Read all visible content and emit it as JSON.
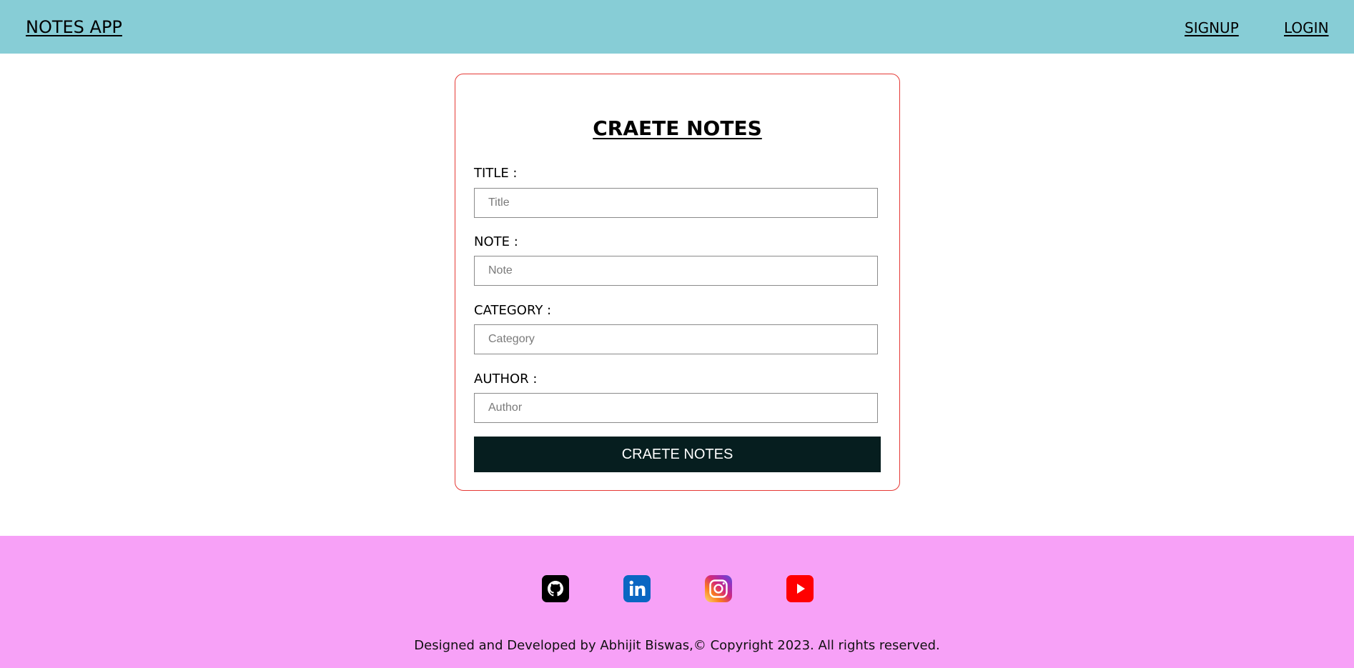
{
  "navbar": {
    "brand": "NOTES APP",
    "links": [
      {
        "label": "SIGNUP"
      },
      {
        "label": "LOGIN"
      }
    ],
    "background": "#87cdd6"
  },
  "form": {
    "title": "CRAETE NOTES",
    "border_color": "#e53935",
    "fields": [
      {
        "label": "TITLE :",
        "placeholder": "Title",
        "value": ""
      },
      {
        "label": "NOTE :",
        "placeholder": "Note",
        "value": ""
      },
      {
        "label": "CATEGORY :",
        "placeholder": "Category",
        "value": ""
      },
      {
        "label": "AUTHOR :",
        "placeholder": "Author",
        "value": ""
      }
    ],
    "submit_label": "CRAETE NOTES",
    "submit_color": "#061e1f"
  },
  "footer": {
    "background": "#f7a1f7",
    "social": [
      {
        "icon": "github-icon"
      },
      {
        "icon": "linkedin-icon"
      },
      {
        "icon": "instagram-icon"
      },
      {
        "icon": "youtube-icon"
      }
    ],
    "copyright": "Designed and Developed by Abhijit Biswas,© Copyright 2023. All rights reserved."
  }
}
